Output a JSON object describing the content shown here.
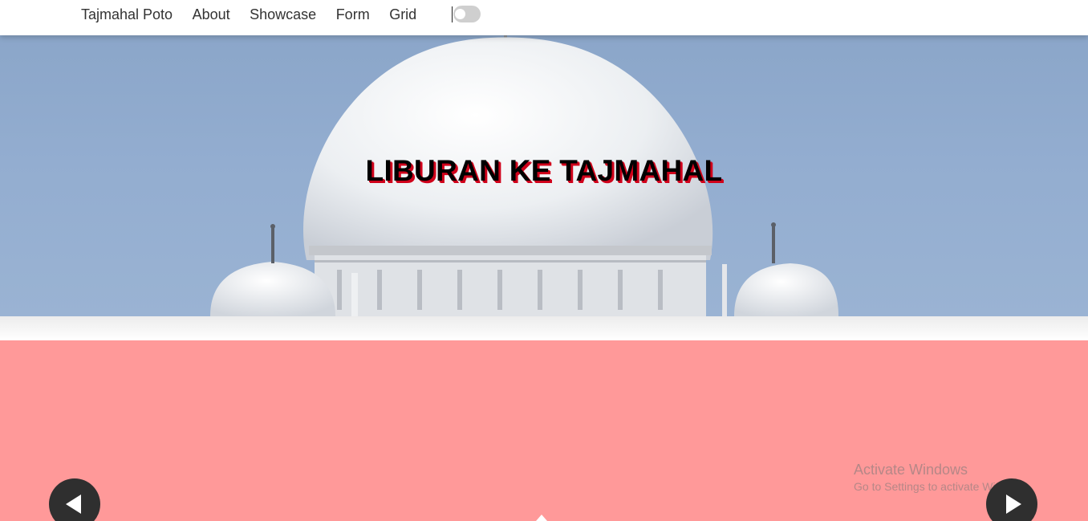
{
  "nav": {
    "brand": "Tajmahal Poto",
    "links": [
      "About",
      "Showcase",
      "Form",
      "Grid"
    ],
    "theme_toggle_on": false
  },
  "hero": {
    "title": "LIBURAN KE TAJMAHAL",
    "title_color": "#000000",
    "title_shadow_color": "#d0021b"
  },
  "slider": {
    "background_color": "#ff9999",
    "prev_icon": "chevron-left-icon",
    "next_icon": "chevron-right-icon"
  },
  "watermark": {
    "title": "Activate Windows",
    "subtitle": "Go to Settings to activate Windows."
  }
}
